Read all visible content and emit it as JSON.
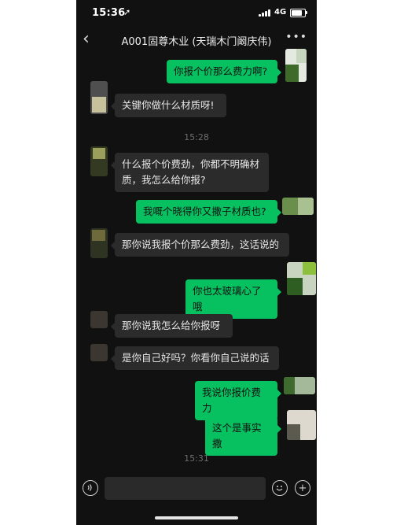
{
  "status_bar": {
    "time": "15:36",
    "network": "4G",
    "battery_level": 0.8
  },
  "nav": {
    "title": "A001固尊木业 (天瑞木门阚庆伟)"
  },
  "messages": [
    {
      "side": "out",
      "text": "你报个价那么费力啊?"
    },
    {
      "side": "in",
      "text": "关键你做什么材质呀!"
    },
    {
      "side": "time",
      "text": "15:28"
    },
    {
      "side": "in",
      "text": "什么报个价费劲，你都不明确材质，我怎么给你报?"
    },
    {
      "side": "out",
      "text": "我嘅个晓得你又撒子材质也?"
    },
    {
      "side": "in",
      "text": "那你说我报个价那么费劲，这话说的"
    },
    {
      "side": "out",
      "text": "你也太玻璃心了哦"
    },
    {
      "side": "in",
      "text": "那你说我怎么给你报呀"
    },
    {
      "side": "in",
      "text": "是你自己好吗？你看你自己说的话"
    },
    {
      "side": "out",
      "text": "我说你报价费力"
    },
    {
      "side": "out",
      "text": "这个是事实撒"
    },
    {
      "side": "time",
      "text": "15:31"
    }
  ],
  "colors": {
    "outgoing_bubble": "#07c160",
    "incoming_bubble": "#2b2b2b",
    "background": "#111111"
  },
  "icons": {
    "voice": "voice-icon",
    "emoji": "emoji-icon",
    "add": "add-icon",
    "back": "back-icon",
    "more": "more-icon"
  }
}
